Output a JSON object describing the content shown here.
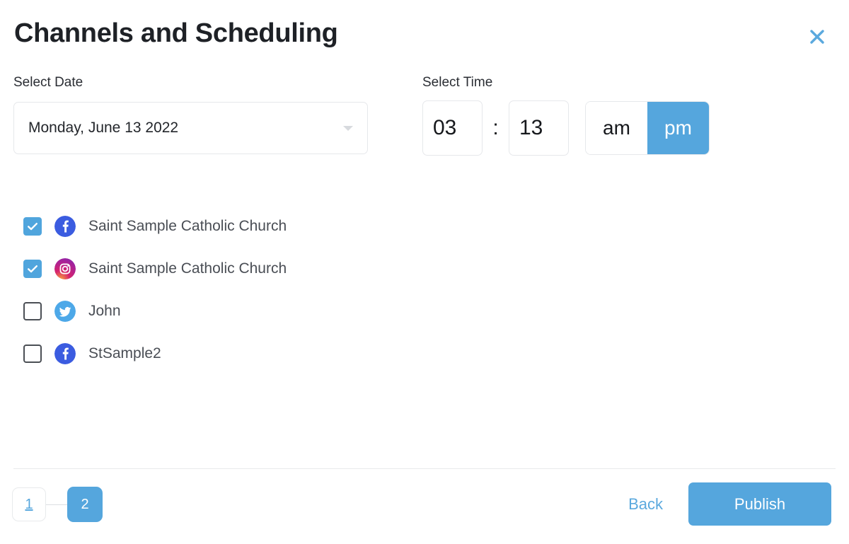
{
  "header": {
    "title": "Channels and Scheduling",
    "close_label": "×"
  },
  "date_field": {
    "label": "Select Date",
    "value": "Monday, June 13 2022"
  },
  "time_field": {
    "label": "Select Time",
    "hour": "03",
    "separator": ":",
    "minute": "13",
    "meridiem_options": [
      "am",
      "pm"
    ],
    "meridiem_selected": "pm"
  },
  "channels": [
    {
      "name": "Saint Sample Catholic Church",
      "network": "facebook",
      "checked": true
    },
    {
      "name": "Saint Sample Catholic Church",
      "network": "instagram",
      "checked": true
    },
    {
      "name": "John",
      "network": "twitter",
      "checked": false
    },
    {
      "name": "StSample2",
      "network": "facebook",
      "checked": false
    }
  ],
  "footer": {
    "steps": [
      {
        "label": "1",
        "current": false
      },
      {
        "label": "2",
        "current": true
      }
    ],
    "back_label": "Back",
    "publish_label": "Publish"
  },
  "colors": {
    "accent_blue": "#55a6dd",
    "facebook_blue": "#3b5ce0",
    "twitter_blue": "#4da8e8",
    "instagram_pink": "#d6236e",
    "instagram_purple": "#7b2bb5",
    "title_text": "#1e2126",
    "body_text": "#4a4e55",
    "border_gray": "#e6e8eb"
  }
}
